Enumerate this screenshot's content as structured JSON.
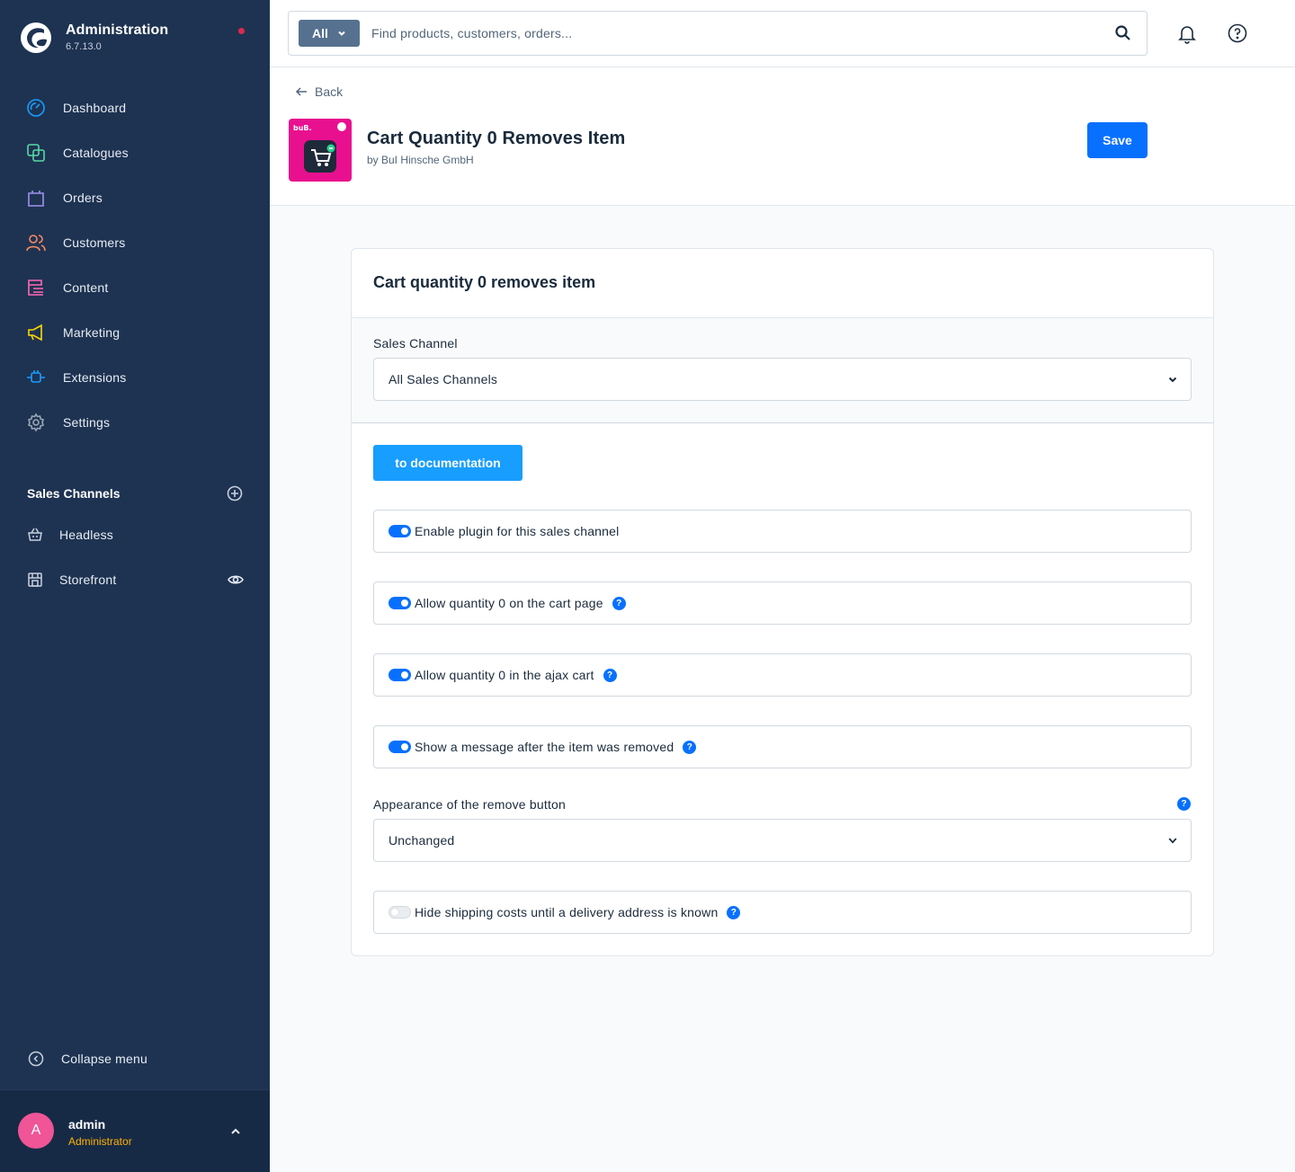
{
  "sidebar": {
    "brand_title": "Administration",
    "brand_version": "6.7.13.0",
    "nav": [
      {
        "label": "Dashboard",
        "icon": "dashboard-icon"
      },
      {
        "label": "Catalogues",
        "icon": "catalogue-icon"
      },
      {
        "label": "Orders",
        "icon": "orders-bag-icon"
      },
      {
        "label": "Customers",
        "icon": "customers-icon"
      },
      {
        "label": "Content",
        "icon": "content-icon"
      },
      {
        "label": "Marketing",
        "icon": "megaphone-icon"
      },
      {
        "label": "Extensions",
        "icon": "plug-icon"
      },
      {
        "label": "Settings",
        "icon": "gear-icon"
      }
    ],
    "sales_channels_title": "Sales Channels",
    "sales_channels": [
      {
        "label": "Headless",
        "icon": "basket-icon"
      },
      {
        "label": "Storefront",
        "icon": "storefront-icon"
      }
    ],
    "collapse_label": "Collapse menu",
    "user": {
      "initial": "A",
      "name": "admin",
      "role": "Administrator"
    }
  },
  "search": {
    "type_label": "All",
    "placeholder": "Find products, customers, orders..."
  },
  "header": {
    "back_label": "Back",
    "app_title": "Cart Quantity 0 Removes Item",
    "app_vendor": "by BuI Hinsche GmbH",
    "save_label": "Save"
  },
  "card": {
    "title": "Cart quantity 0 removes item",
    "sales_channel_label": "Sales Channel",
    "sales_channel_value": "All Sales Channels",
    "doc_button": "to documentation",
    "toggles": [
      {
        "label": "Enable plugin for this sales channel",
        "on": true,
        "help": false
      },
      {
        "label": "Allow quantity 0 on the cart page",
        "on": true,
        "help": true
      },
      {
        "label": "Allow quantity 0 in the ajax cart",
        "on": true,
        "help": true
      },
      {
        "label": "Show a message after the item was removed",
        "on": true,
        "help": true
      }
    ],
    "appearance_label": "Appearance of the remove button",
    "appearance_value": "Unchanged",
    "shipping_toggle": {
      "label": "Hide shipping costs until a delivery address is known",
      "on": false,
      "help": true
    }
  },
  "colors": {
    "sidebar_bg": "#1e3352",
    "primary": "#0870ff",
    "doc_button": "#189eff",
    "app_icon_bg": "#e8108f",
    "role_color": "#ffb200"
  }
}
